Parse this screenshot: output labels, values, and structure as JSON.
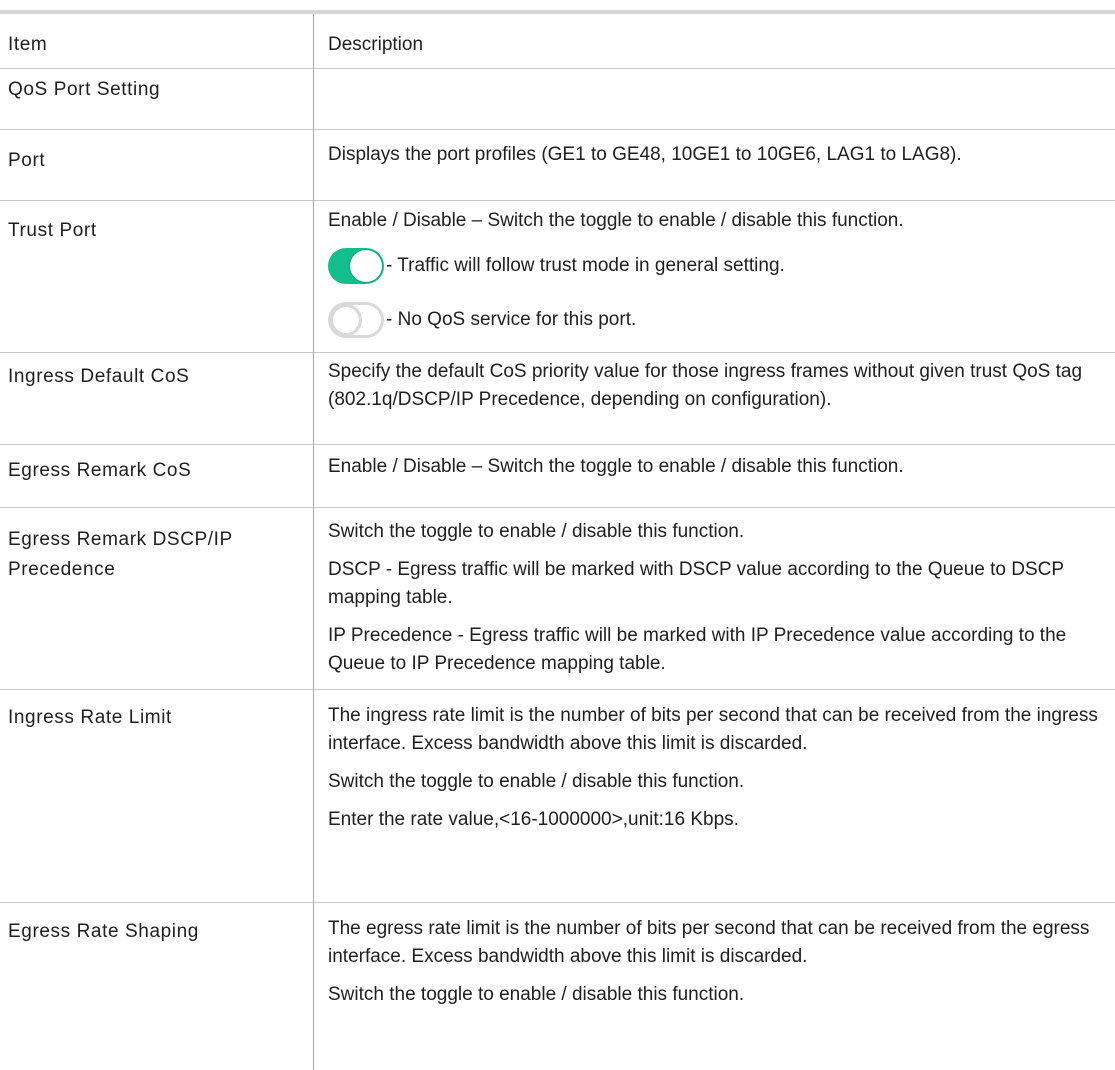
{
  "header": {
    "item": "Item",
    "description": "Description"
  },
  "section_title": "QoS Port Setting",
  "rows": [
    {
      "item": "Port",
      "desc": [
        "Displays the port profiles (GE1 to GE48, 10GE1 to 10GE6, LAG1 to LAG8)."
      ]
    },
    {
      "item": "Trust Port",
      "desc": [
        "Enable / Disable – Switch the toggle to enable / disable this function."
      ],
      "toggle_on_text": "- Traffic will follow trust mode in general setting.",
      "toggle_off_text": "- No QoS service for this port."
    },
    {
      "item": "Ingress Default CoS",
      "desc": [
        "Specify the default CoS priority value for those ingress frames without given trust QoS tag (802.1q/DSCP/IP Precedence, depending on configuration)."
      ]
    },
    {
      "item": "Egress Remark CoS",
      "desc": [
        "Enable / Disable – Switch the toggle to enable / disable this function."
      ]
    },
    {
      "item": "Egress Remark DSCP/IP Precedence",
      "desc": [
        "Switch the toggle to enable / disable this function.",
        "DSCP - Egress traffic will be marked with DSCP value according to the Queue to DSCP mapping table.",
        "IP Precedence - Egress traffic will be marked with IP Precedence value according to the Queue to IP Precedence mapping table."
      ]
    },
    {
      "item": "Ingress Rate Limit",
      "desc": [
        "The ingress rate limit is the number of bits per second that can be received from the ingress interface. Excess bandwidth above this limit is discarded.",
        "Switch the toggle to enable / disable this function.",
        "Enter the rate value,<16-1000000>,unit:16 Kbps."
      ]
    },
    {
      "item": "Egress Rate Shaping",
      "desc": [
        "The egress rate limit is the number of bits per second that can be received from the egress interface. Excess bandwidth above this limit is discarded.",
        "Switch the toggle to enable / disable this function."
      ]
    }
  ],
  "colors": {
    "toggle_on": "#12be8c",
    "toggle_off_border": "#d9d9d9",
    "rule": "#c9c9c9"
  }
}
